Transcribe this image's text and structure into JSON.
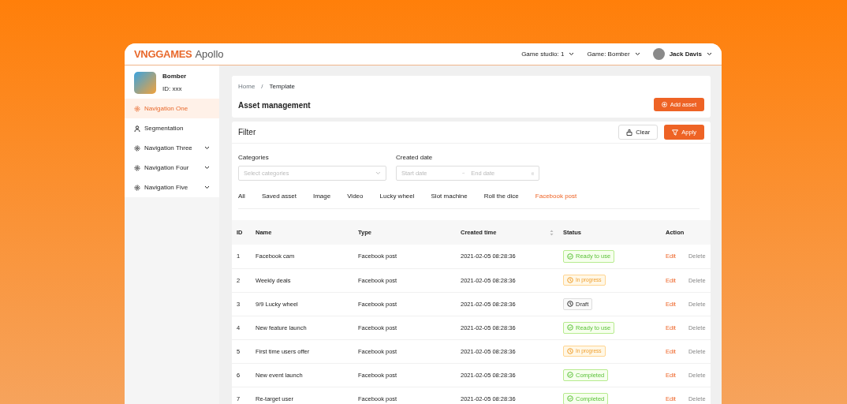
{
  "header": {
    "logo_brand": "VNGGAMES",
    "logo_product": "Apollo",
    "menus": [
      {
        "label": "Game studio: 1"
      },
      {
        "label": "Game: Bomber"
      }
    ],
    "user": {
      "name": "Jack Davis"
    }
  },
  "sidebar": {
    "game": {
      "name": "Bomber",
      "id": "ID: xxx"
    },
    "items": [
      {
        "label": "Navigation One",
        "selected": true,
        "expandable": false
      },
      {
        "label": "Segmentation",
        "selected": false,
        "expandable": false
      },
      {
        "label": "Navigation Three",
        "selected": false,
        "expandable": true
      },
      {
        "label": "Navigation Four",
        "selected": false,
        "expandable": true
      },
      {
        "label": "Navigation Five",
        "selected": false,
        "expandable": true
      }
    ]
  },
  "breadcrumb": [
    "Home",
    "Template"
  ],
  "breadcrumb_separator": "/",
  "page_title": "Asset management",
  "add_button": "Add asset",
  "filter": {
    "title": "Filter",
    "clear": "Clear",
    "apply": "Apply",
    "categories": {
      "label": "Categories",
      "placeholder": "Select categories"
    },
    "created_date": {
      "label": "Created date",
      "start_placeholder": "Start date",
      "end_placeholder": "End date"
    },
    "tabs": [
      {
        "label": "All",
        "selected": false
      },
      {
        "label": "Saved asset",
        "selected": false
      },
      {
        "label": "Image",
        "selected": false
      },
      {
        "label": "Video",
        "selected": false
      },
      {
        "label": "Lucky wheel",
        "selected": false
      },
      {
        "label": "Slot machine",
        "selected": false
      },
      {
        "label": "Roll the dice",
        "selected": false
      },
      {
        "label": "Facebook post",
        "selected": true
      }
    ]
  },
  "table": {
    "columns": [
      "ID",
      "Name",
      "Type",
      "Created time",
      "Status",
      "Action"
    ],
    "rows": [
      {
        "id": "1",
        "name": "Facebook cam",
        "type": "Facebook post",
        "created": "2021-02-05 08:28:36",
        "status": {
          "label": "Ready to use",
          "kind": "ready"
        },
        "actions": [
          "Edit",
          "Delete"
        ]
      },
      {
        "id": "2",
        "name": "Weekly deals",
        "type": "Facebook post",
        "created": "2021-02-05 08:28:36",
        "status": {
          "label": "In progress",
          "kind": "progress"
        },
        "actions": [
          "Edit",
          "Delete"
        ]
      },
      {
        "id": "3",
        "name": "9/9 Lucky wheel",
        "type": "Facebook post",
        "created": "2021-02-05 08:28:36",
        "status": {
          "label": "Draft",
          "kind": "draft"
        },
        "actions": [
          "Edit",
          "Delete"
        ]
      },
      {
        "id": "4",
        "name": "New feature launch",
        "type": "Facebook post",
        "created": "2021-02-05 08:28:36",
        "status": {
          "label": "Ready to use",
          "kind": "ready"
        },
        "actions": [
          "Edit",
          "Delete"
        ]
      },
      {
        "id": "5",
        "name": "First time users offer",
        "type": "Facebook post",
        "created": "2021-02-05 08:28:36",
        "status": {
          "label": "In progress",
          "kind": "progress"
        },
        "actions": [
          "Edit",
          "Delete"
        ]
      },
      {
        "id": "6",
        "name": "New event launch",
        "type": "Facebook post",
        "created": "2021-02-05 08:28:36",
        "status": {
          "label": "Completed",
          "kind": "ready"
        },
        "actions": [
          "Edit",
          "Delete"
        ]
      },
      {
        "id": "7",
        "name": "Re-target user",
        "type": "Facebook post",
        "created": "2021-02-05 08:28:36",
        "status": {
          "label": "Completed",
          "kind": "ready"
        },
        "actions": [
          "Edit",
          "Delete"
        ]
      }
    ]
  }
}
